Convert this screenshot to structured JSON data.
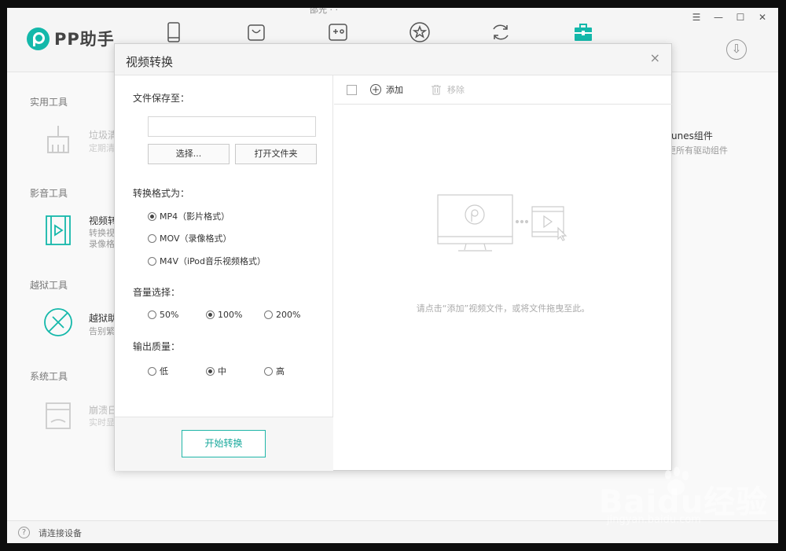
{
  "app": {
    "logo_text": "PP助手",
    "title_fragment": "邵光 · ·",
    "status_text": "请连接设备",
    "download_label": "⇩"
  },
  "nav": {
    "icons": [
      "phone-icon",
      "apps-bag-icon",
      "games-icon",
      "favorites-star-icon",
      "sync-icon",
      "toolbox-icon"
    ],
    "active": "toolbox-icon",
    "accent_color": "#14b8aa"
  },
  "window_controls": {
    "menu": "☰",
    "minimize": "—",
    "maximize": "☐",
    "close": "✕"
  },
  "sections": [
    {
      "title": "实用工具",
      "tools": [
        {
          "name": "垃圾清",
          "desc": "定期清"
        }
      ]
    },
    {
      "title": "影音工具",
      "tools": [
        {
          "name": "视频转",
          "desc": "转换视\n录像格"
        }
      ]
    },
    {
      "title": "越狱工具",
      "tools": [
        {
          "name": "越狱助",
          "desc": "告别繁"
        }
      ]
    },
    {
      "title": "系统工具",
      "tools": [
        {
          "name": "崩溃日",
          "desc": "实时显"
        }
      ]
    }
  ],
  "right_tool": {
    "name": "unes组件",
    "desc": "更所有驱动组件"
  },
  "dialog": {
    "title": "视频转换",
    "close": "×",
    "save_to_label": "文件保存至：",
    "path_value": "",
    "select_button": "选择...",
    "open_folder_button": "打开文件夹",
    "format_label": "转换格式为：",
    "formats": [
      {
        "label": "MP4（影片格式）",
        "checked": true
      },
      {
        "label": "MOV（录像格式）",
        "checked": false
      },
      {
        "label": "M4V（iPod音乐视频格式）",
        "checked": false
      }
    ],
    "volume_label": "音量选择：",
    "volumes": [
      {
        "label": "50%",
        "checked": false
      },
      {
        "label": "100%",
        "checked": true
      },
      {
        "label": "200%",
        "checked": false
      }
    ],
    "quality_label": "输出质量：",
    "qualities": [
      {
        "label": "低",
        "checked": false
      },
      {
        "label": "中",
        "checked": true
      },
      {
        "label": "高",
        "checked": false
      }
    ],
    "start_button": "开始转换",
    "toolbar": {
      "add_label": "添加",
      "remove_label": "移除"
    },
    "empty_hint": "请点击“添加”视频文件，或将文件拖曳至此。"
  },
  "watermark": {
    "text": "Baidu经验",
    "url": "jingyan.baidu.com"
  }
}
